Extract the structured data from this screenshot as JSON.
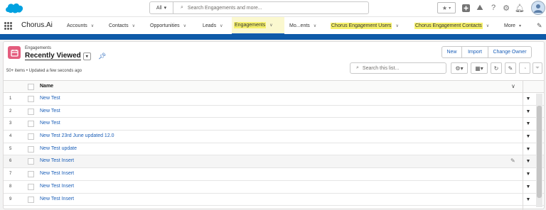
{
  "colors": {
    "brand": "#00a1e0",
    "nav_active": "#1b5fb8",
    "highlight": "#f5f06a",
    "object_icon": "#e45d7e",
    "link": "#1b5fb8"
  },
  "global_search": {
    "scope": "All",
    "placeholder": "Search Engagements and more..."
  },
  "app": {
    "name": "Chorus.Ai"
  },
  "nav": [
    {
      "label": "Accounts"
    },
    {
      "label": "Contacts"
    },
    {
      "label": "Opportunities"
    },
    {
      "label": "Leads"
    },
    {
      "label": "Engagements"
    },
    {
      "label": "Mo...ents"
    },
    {
      "label": "Chorus Engagement Users"
    },
    {
      "label": "Chorus Engagement Contacts"
    },
    {
      "label": "More"
    }
  ],
  "list": {
    "object_label": "Engagements",
    "view_name": "Recently Viewed",
    "summary": "50+ items • Updated a few seconds ago",
    "search_placeholder": "Search this list...",
    "buttons": {
      "new": "New",
      "import": "Import",
      "change_owner": "Change Owner"
    },
    "column_name": "Name",
    "rows": [
      {
        "num": "1",
        "name": "New Test"
      },
      {
        "num": "2",
        "name": "New Test"
      },
      {
        "num": "3",
        "name": "New Test"
      },
      {
        "num": "4",
        "name": "New Test 23rd June updated 12.0"
      },
      {
        "num": "5",
        "name": "New Test update"
      },
      {
        "num": "6",
        "name": "New Test Insert"
      },
      {
        "num": "7",
        "name": "New Test Insert"
      },
      {
        "num": "8",
        "name": "New Test Insert"
      },
      {
        "num": "9",
        "name": "New Test Insert"
      }
    ]
  }
}
